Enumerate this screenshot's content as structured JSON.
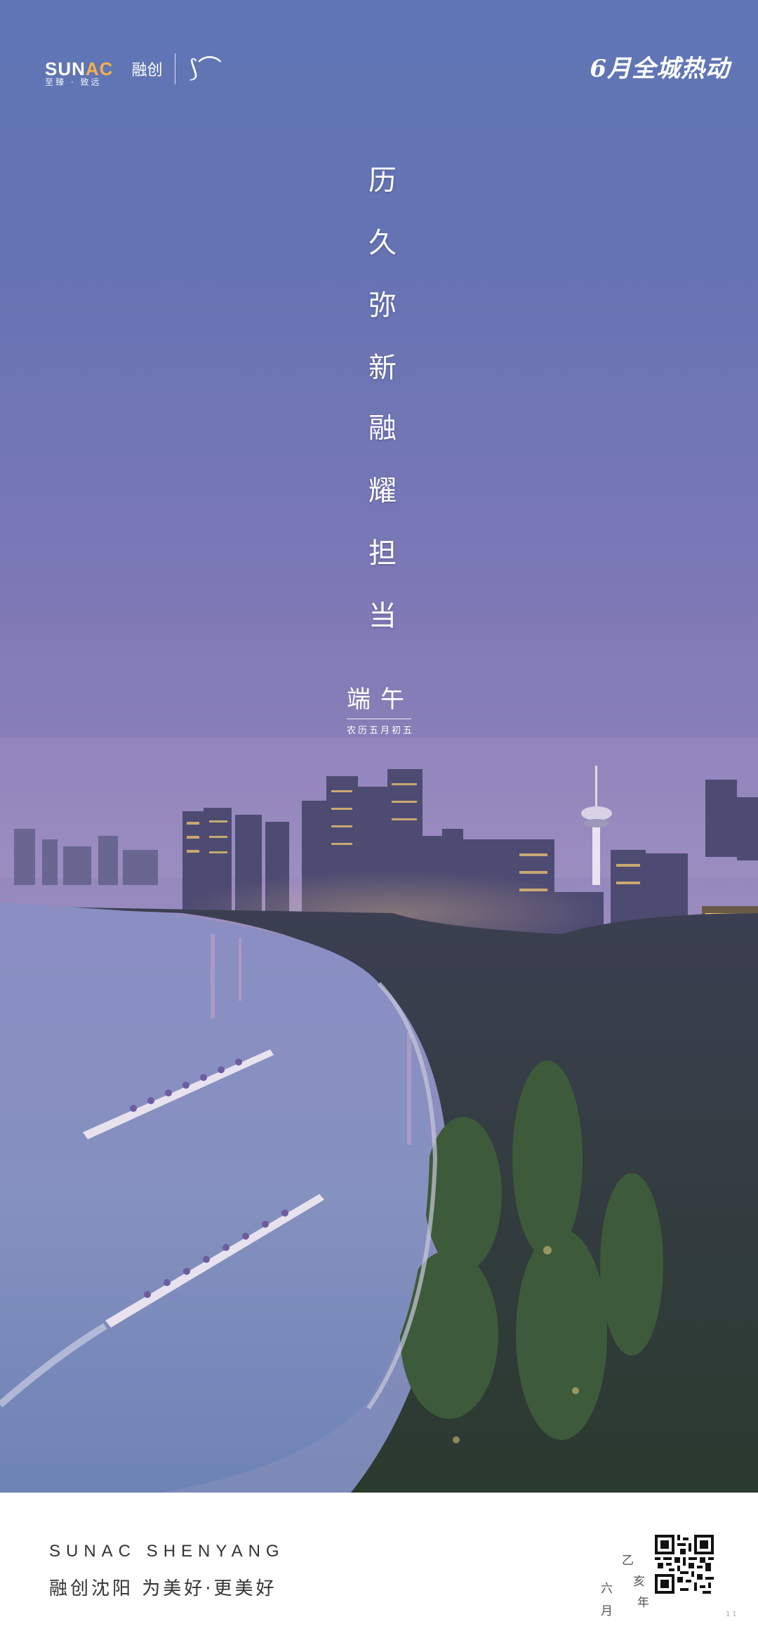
{
  "header": {
    "brand_name": "SUNAC",
    "brand_cn": "融创",
    "brand_slogan": "至臻 · 致远",
    "event_text": "6月全城热动"
  },
  "headline": {
    "line1": "历久弥新",
    "line2": "融耀担当"
  },
  "festival": {
    "name": "端午",
    "lunar_date": "农历五月初五"
  },
  "footer": {
    "en_title": "SUNAC SHENYANG",
    "cn_title": "融创沈阳  为美好·更美好",
    "date_chars": {
      "a": "乙",
      "b": "亥",
      "c": "年",
      "d": "六",
      "e": "月"
    },
    "page_mark": "11"
  },
  "colors": {
    "sky_top": "#5f76b6",
    "sky_mid": "#8b80b8",
    "water": "#8a8fc0",
    "city_lights": "#f3c56b"
  }
}
